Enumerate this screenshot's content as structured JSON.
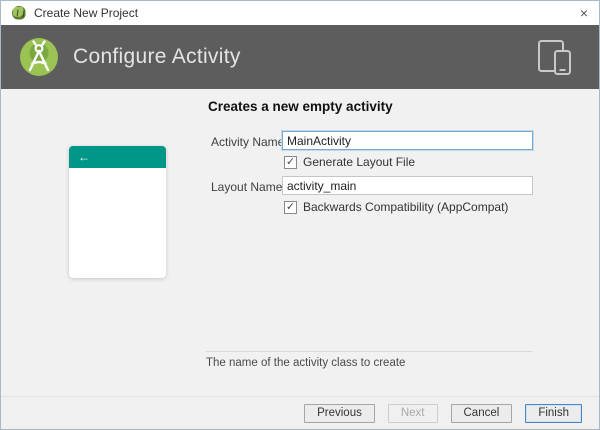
{
  "window": {
    "title": "Create New Project",
    "close_glyph": "×"
  },
  "header": {
    "title": "Configure Activity",
    "logo_icon": "android-studio-logo",
    "devices_icon": "phone-tablet-icon"
  },
  "content": {
    "heading": "Creates a new empty activity",
    "fields": {
      "activity_name": {
        "label": "Activity Name:",
        "value": "MainActivity"
      },
      "layout_name": {
        "label": "Layout Name:",
        "value": "activity_main"
      }
    },
    "checkboxes": {
      "generate_layout": {
        "label": "Generate Layout File",
        "checked": true,
        "glyph": "✓"
      },
      "backwards_compat": {
        "label": "Backwards Compatibility (AppCompat)",
        "checked": true,
        "glyph": "✓"
      }
    },
    "preview": {
      "back_arrow": "←"
    },
    "hint": "The name of the activity class to create"
  },
  "footer": {
    "previous_label": "Previous",
    "next_label": "Next",
    "cancel_label": "Cancel",
    "finish_label": "Finish"
  },
  "colors": {
    "header_bg": "#5d5d5d",
    "appbar_teal": "#009688",
    "content_bg": "#f1f1f1",
    "focus_border": "#7aa7cf",
    "default_button_border": "#4b84c4"
  }
}
